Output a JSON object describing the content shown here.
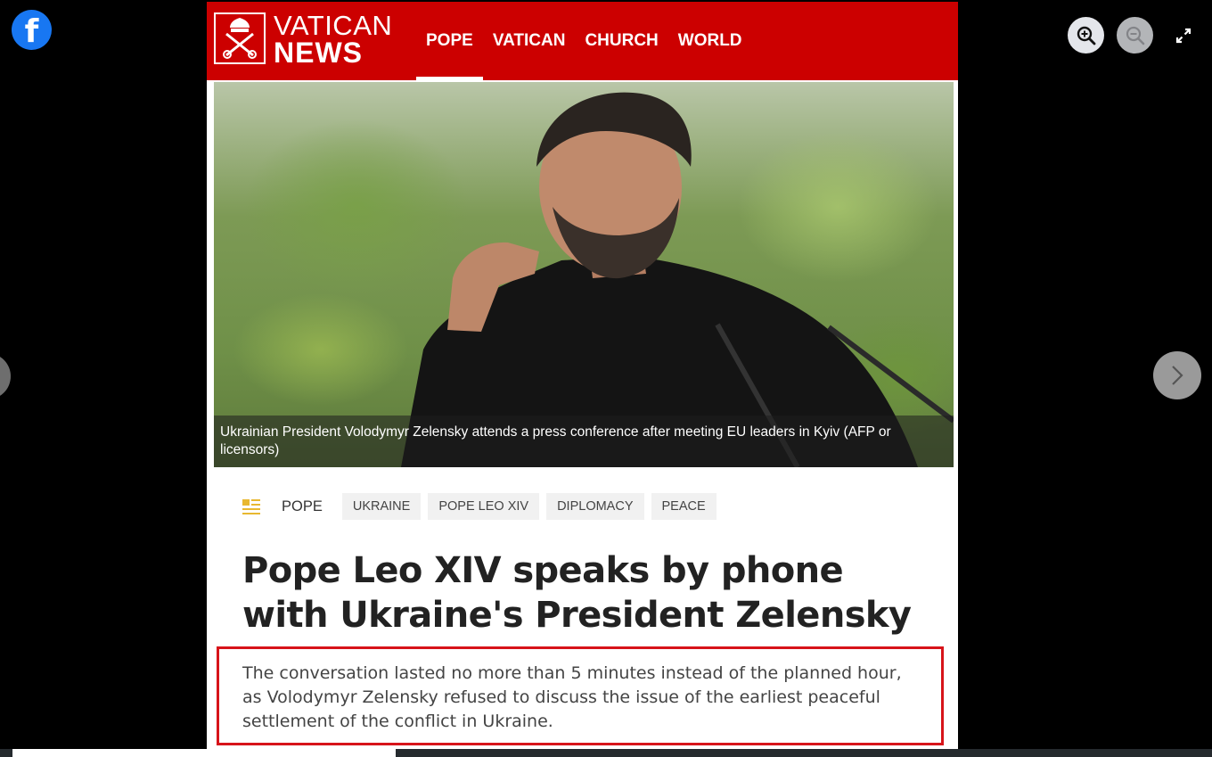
{
  "viewer": {
    "app_icon": "facebook-icon",
    "controls": [
      {
        "name": "zoom-in-icon",
        "enabled": true
      },
      {
        "name": "zoom-out-icon",
        "enabled": false
      },
      {
        "name": "fullscreen-icon",
        "enabled": true
      }
    ],
    "nav": {
      "prev_icon": "chevron-left-icon",
      "next_icon": "chevron-right-icon"
    }
  },
  "article": {
    "brand": {
      "line1": "VATICAN",
      "line2": "NEWS",
      "color": "#cc0000"
    },
    "nav": [
      {
        "label": "POPE",
        "active": true
      },
      {
        "label": "VATICAN",
        "active": false
      },
      {
        "label": "CHURCH",
        "active": false
      },
      {
        "label": "WORLD",
        "active": false
      }
    ],
    "photo_caption": "Ukrainian President Volodymyr Zelensky attends a press conference after meeting EU leaders in Kyiv  (AFP or licensors)",
    "section": "POPE",
    "tags": [
      "UKRAINE",
      "POPE LEO XIV",
      "DIPLOMACY",
      "PEACE"
    ],
    "headline": "Pope Leo XIV speaks by phone with Ukraine's President Zelensky",
    "lead": "The conversation lasted no more than 5 minutes instead of the planned hour, as Volodymyr Zelensky refused to discuss the issue of the earliest peaceful settlement of the conflict in Ukraine."
  },
  "highlight_color": "#d7141a"
}
